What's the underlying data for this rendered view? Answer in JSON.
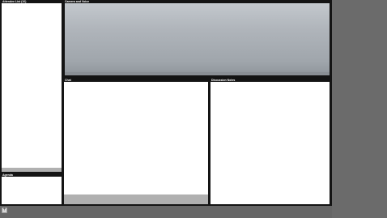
{
  "panels": {
    "attendees": {
      "title": "Attendee List (10)"
    },
    "camera": {
      "title": "Camera and Voice"
    },
    "agenda": {
      "title": "Agenda"
    },
    "chat": {
      "title": "Chat"
    },
    "notes": {
      "title": "Discussion Notes"
    }
  },
  "footer": {
    "add_button_label": "+"
  },
  "colors": {
    "app_background": "#141414",
    "panel_background": "#ffffff",
    "desktop": "#6a6a6a"
  }
}
